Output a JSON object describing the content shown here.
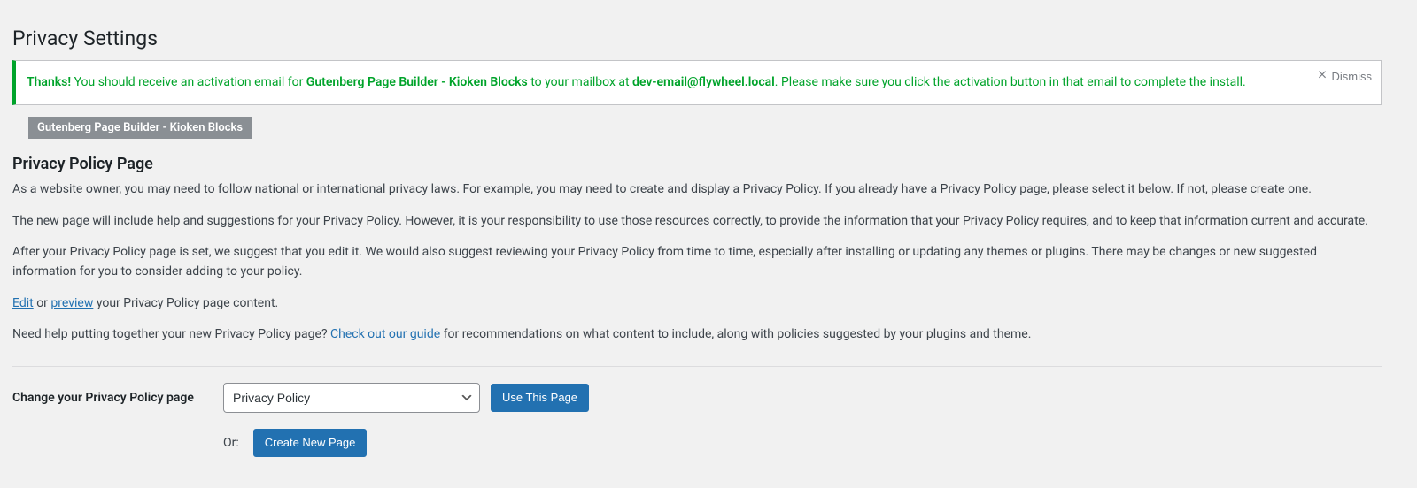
{
  "page": {
    "title": "Privacy Settings",
    "section_title": "Privacy Policy Page"
  },
  "notice": {
    "prefix_strong": "Thanks!",
    "text_1": " You should receive an activation email for ",
    "plugin_strong": "Gutenberg Page Builder - Kioken Blocks",
    "text_2": " to your mailbox at ",
    "email_strong": "dev-email@flywheel.local",
    "text_3": ". Please make sure you click the activation button in that email to complete the install.",
    "dismiss_label": "Dismiss"
  },
  "badge": {
    "label": "Gutenberg Page Builder - Kioken Blocks"
  },
  "content": {
    "p1": "As a website owner, you may need to follow national or international privacy laws. For example, you may need to create and display a Privacy Policy. If you already have a Privacy Policy page, please select it below. If not, please create one.",
    "p2": "The new page will include help and suggestions for your Privacy Policy. However, it is your responsibility to use those resources correctly, to provide the information that your Privacy Policy requires, and to keep that information current and accurate.",
    "p3": "After your Privacy Policy page is set, we suggest that you edit it. We would also suggest reviewing your Privacy Policy from time to time, especially after installing or updating any themes or plugins. There may be changes or new suggested information for you to consider adding to your policy.",
    "edit_link": "Edit",
    "or_word": " or ",
    "preview_link": "preview",
    "edit_suffix": " your Privacy Policy page content.",
    "help_prefix": "Need help putting together your new Privacy Policy page? ",
    "guide_link": "Check out our guide",
    "help_suffix": " for recommendations on what content to include, along with policies suggested by your plugins and theme."
  },
  "form": {
    "label": "Change your Privacy Policy page",
    "selected_option": "Privacy Policy",
    "use_button": "Use This Page",
    "or_label": "Or:",
    "create_button": "Create New Page"
  }
}
